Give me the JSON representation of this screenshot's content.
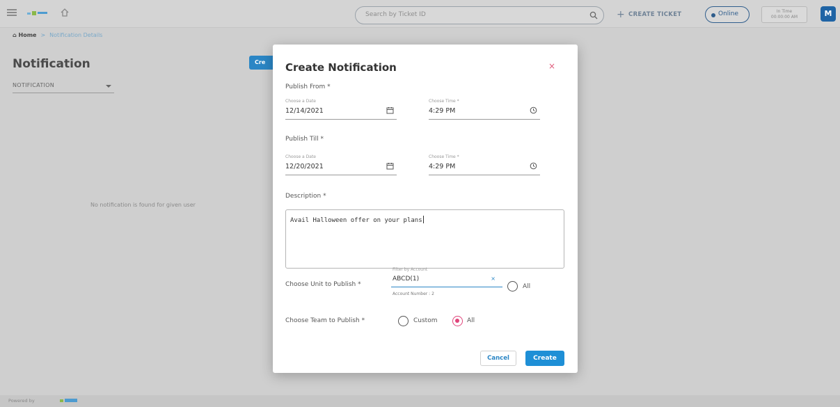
{
  "topbar": {
    "search_placeholder": "Search by Ticket ID",
    "create_ticket_label": "CREATE TICKET",
    "online_label": "Online",
    "time_line1": "In Time",
    "time_line2": "00:00:00 AM",
    "avatar_initial": "M"
  },
  "breadcrumb": {
    "home": "Home",
    "current": "Notification Details"
  },
  "page": {
    "title": "Notification",
    "select_value": "NOTIFICATION",
    "create_button_label": "Cre",
    "empty_message": "No notification is found for given user"
  },
  "modal": {
    "title": "Create Notification",
    "close_symbol": "×",
    "publish_from_label": "Publish From *",
    "publish_from": {
      "date_caption": "Choose a Date",
      "date_value": "12/14/2021",
      "time_caption": "Choose Time *",
      "time_value": "4:29 PM"
    },
    "publish_till_label": "Publish Till *",
    "publish_till": {
      "date_caption": "Choose a Date",
      "date_value": "12/20/2021",
      "time_caption": "Choose Time *",
      "time_value": "4:29 PM"
    },
    "description_label": "Description *",
    "description_value": "Avail Halloween offer on your plans",
    "unit": {
      "label": "Choose Unit to Publish *",
      "caption": "Filter by Account",
      "value": "ABCD(1)",
      "clear_symbol": "×",
      "subtext": "Account Number : 2",
      "all_label": "All"
    },
    "team": {
      "label": "Choose Team to Publish *",
      "custom_label": "Custom",
      "all_label": "All"
    },
    "cancel_label": "Cancel",
    "create_label": "Create"
  },
  "footer": {
    "powered_by": "Powered by"
  },
  "colors": {
    "primary": "#1e8fd6",
    "accent_pink": "#e0457b",
    "online": "#2f5d8c"
  }
}
